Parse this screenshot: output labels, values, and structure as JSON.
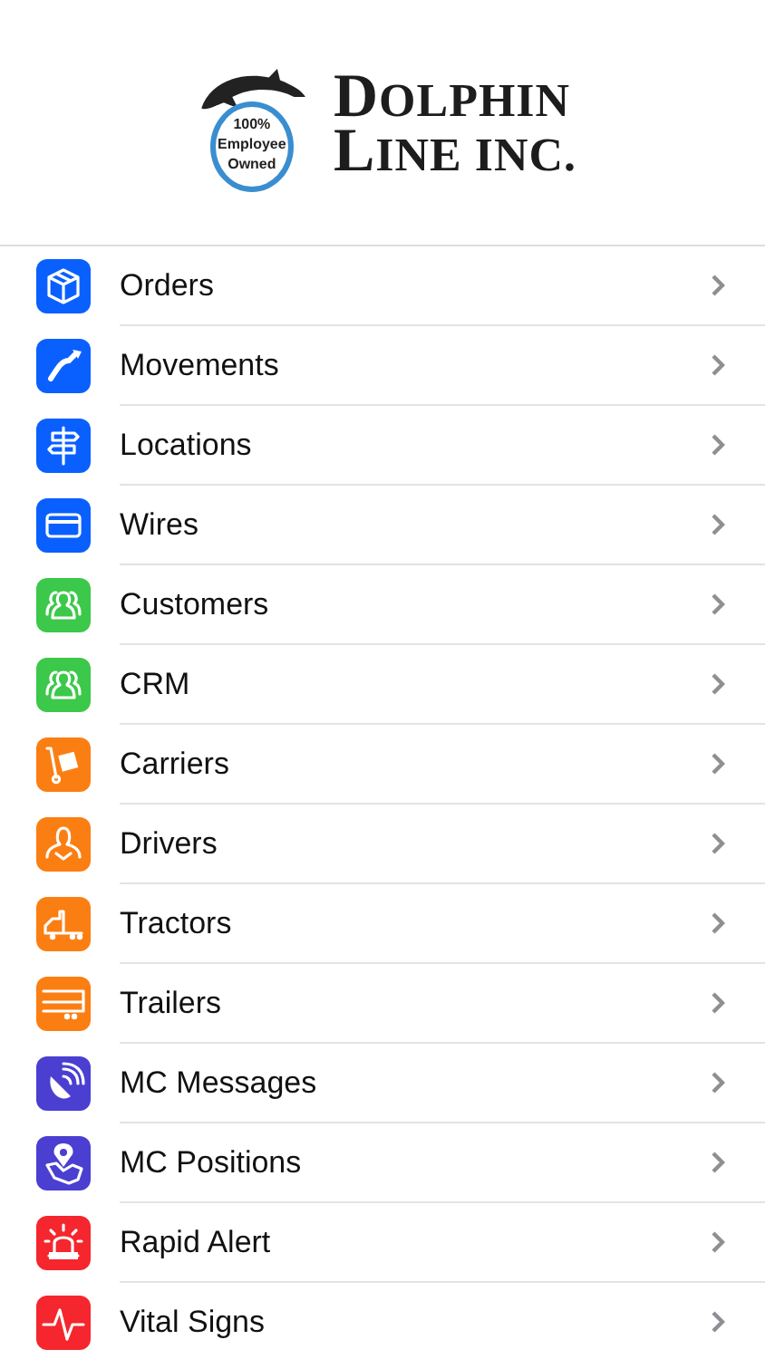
{
  "logo": {
    "badge": [
      "100%",
      "Employee",
      "Owned"
    ],
    "name": [
      "DOLPHIN",
      "LINE INC."
    ]
  },
  "menu": [
    {
      "label": "Orders",
      "kind": "box",
      "color": "#0a60ff"
    },
    {
      "label": "Movements",
      "kind": "route",
      "color": "#0a60ff"
    },
    {
      "label": "Locations",
      "kind": "signpost",
      "color": "#0a60ff"
    },
    {
      "label": "Wires",
      "kind": "card",
      "color": "#0a60ff"
    },
    {
      "label": "Customers",
      "kind": "people",
      "color": "#3cc84a"
    },
    {
      "label": "CRM",
      "kind": "people",
      "color": "#3cc84a"
    },
    {
      "label": "Carriers",
      "kind": "dolly",
      "color": "#fb7e12"
    },
    {
      "label": "Drivers",
      "kind": "person",
      "color": "#fb7e12"
    },
    {
      "label": "Tractors",
      "kind": "truck",
      "color": "#fb7e12"
    },
    {
      "label": "Trailers",
      "kind": "trailer",
      "color": "#fb7e12"
    },
    {
      "label": "MC Messages",
      "kind": "satellite",
      "color": "#4a3fd0"
    },
    {
      "label": "MC Positions",
      "kind": "pin",
      "color": "#4a3fd0"
    },
    {
      "label": "Rapid Alert",
      "kind": "siren",
      "color": "#f5262d"
    },
    {
      "label": "Vital Signs",
      "kind": "pulse",
      "color": "#f5262d"
    }
  ]
}
